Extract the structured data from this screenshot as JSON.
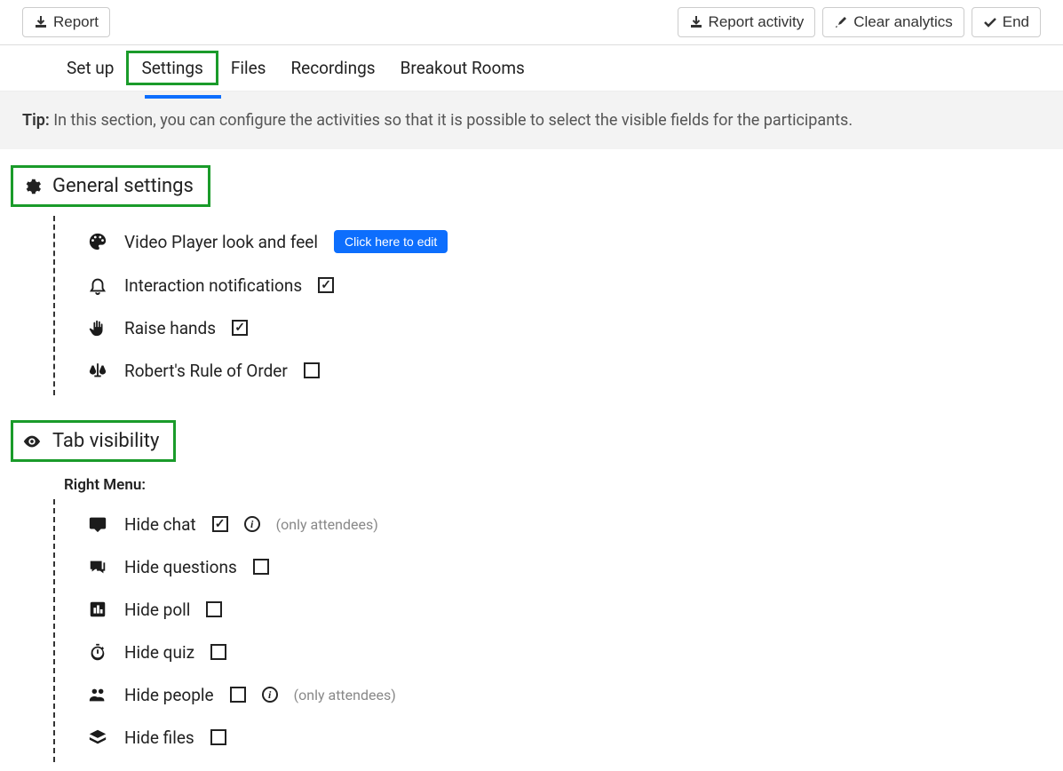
{
  "topbar": {
    "report": "Report",
    "report_activity": "Report activity",
    "clear_analytics": "Clear analytics",
    "end": "End"
  },
  "tabs": {
    "setup": "Set up",
    "settings": "Settings",
    "files": "Files",
    "recordings": "Recordings",
    "breakout": "Breakout Rooms"
  },
  "tip": {
    "label": "Tip:",
    "text": "In this section, you can configure the activities so that it is possible to select the visible fields for the participants."
  },
  "sections": {
    "general": {
      "title": "General settings",
      "video_player": "Video Player look and feel",
      "video_player_btn": "Click here to edit",
      "interaction_notifications": "Interaction notifications",
      "raise_hands": "Raise hands",
      "roberts_rule": "Robert's Rule of Order"
    },
    "tab_visibility": {
      "title": "Tab visibility",
      "right_menu": "Right Menu:",
      "hide_chat": "Hide chat",
      "hide_questions": "Hide questions",
      "hide_poll": "Hide poll",
      "hide_quiz": "Hide quiz",
      "hide_people": "Hide people",
      "hide_files": "Hide files",
      "only_attendees": "(only attendees)"
    }
  },
  "checkboxes": {
    "interaction_notifications": true,
    "raise_hands": true,
    "roberts_rule": false,
    "hide_chat": true,
    "hide_questions": false,
    "hide_poll": false,
    "hide_quiz": false,
    "hide_people": false,
    "hide_files": false
  }
}
